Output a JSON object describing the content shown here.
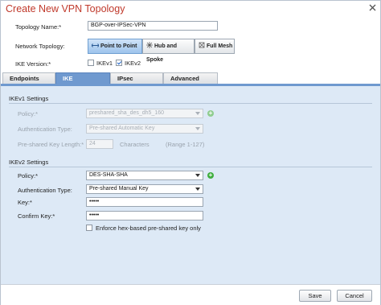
{
  "dialog": {
    "title": "Create New VPN Topology",
    "close_icon": "close-icon"
  },
  "form": {
    "topology_name_label": "Topology Name:*",
    "topology_name_value": "BGP-over-IPSec-VPN",
    "network_topology_label": "Network Topology:",
    "topology_options": [
      {
        "label": "Point to Point",
        "icon": "point-to-point-icon",
        "active": true
      },
      {
        "label": "Hub and Spoke",
        "icon": "hub-spoke-icon",
        "active": false
      },
      {
        "label": "Full Mesh",
        "icon": "full-mesh-icon",
        "active": false
      }
    ],
    "ike_version_label": "IKE Version:*",
    "ikev1_label": "IKEv1",
    "ikev1_checked": false,
    "ikev2_label": "IKEv2",
    "ikev2_checked": true
  },
  "tabs": [
    {
      "label": "Endpoints",
      "active": false
    },
    {
      "label": "IKE",
      "active": true
    },
    {
      "label": "IPsec",
      "active": false
    },
    {
      "label": "Advanced",
      "active": false
    }
  ],
  "ikev1": {
    "section_title": "IKEv1 Settings",
    "policy_label": "Policy:*",
    "policy_value": "preshared_sha_des_dh5_160",
    "auth_type_label": "Authentication Type:",
    "auth_type_value": "Pre-shared Automatic Key",
    "key_length_label": "Pre-shared Key Length:*",
    "key_length_value": "24",
    "characters_label": "Characters",
    "range_label": "(Range 1-127)"
  },
  "ikev2": {
    "section_title": "IKEv2 Settings",
    "policy_label": "Policy:*",
    "policy_value": "DES-SHA-SHA",
    "auth_type_label": "Authentication Type:",
    "auth_type_value": "Pre-shared Manual Key",
    "key_label": "Key:*",
    "key_value": "•••••",
    "confirm_key_label": "Confirm Key:*",
    "confirm_key_value": "•••••",
    "enforce_hex_label": "Enforce hex-based pre-shared key only",
    "enforce_hex_checked": false
  },
  "footer": {
    "save_label": "Save",
    "cancel_label": "Cancel"
  },
  "colors": {
    "title": "#c0392b",
    "tab_active": "#6f99cf",
    "panel_bg": "#dde9f6",
    "add_green": "#3fae3f"
  }
}
